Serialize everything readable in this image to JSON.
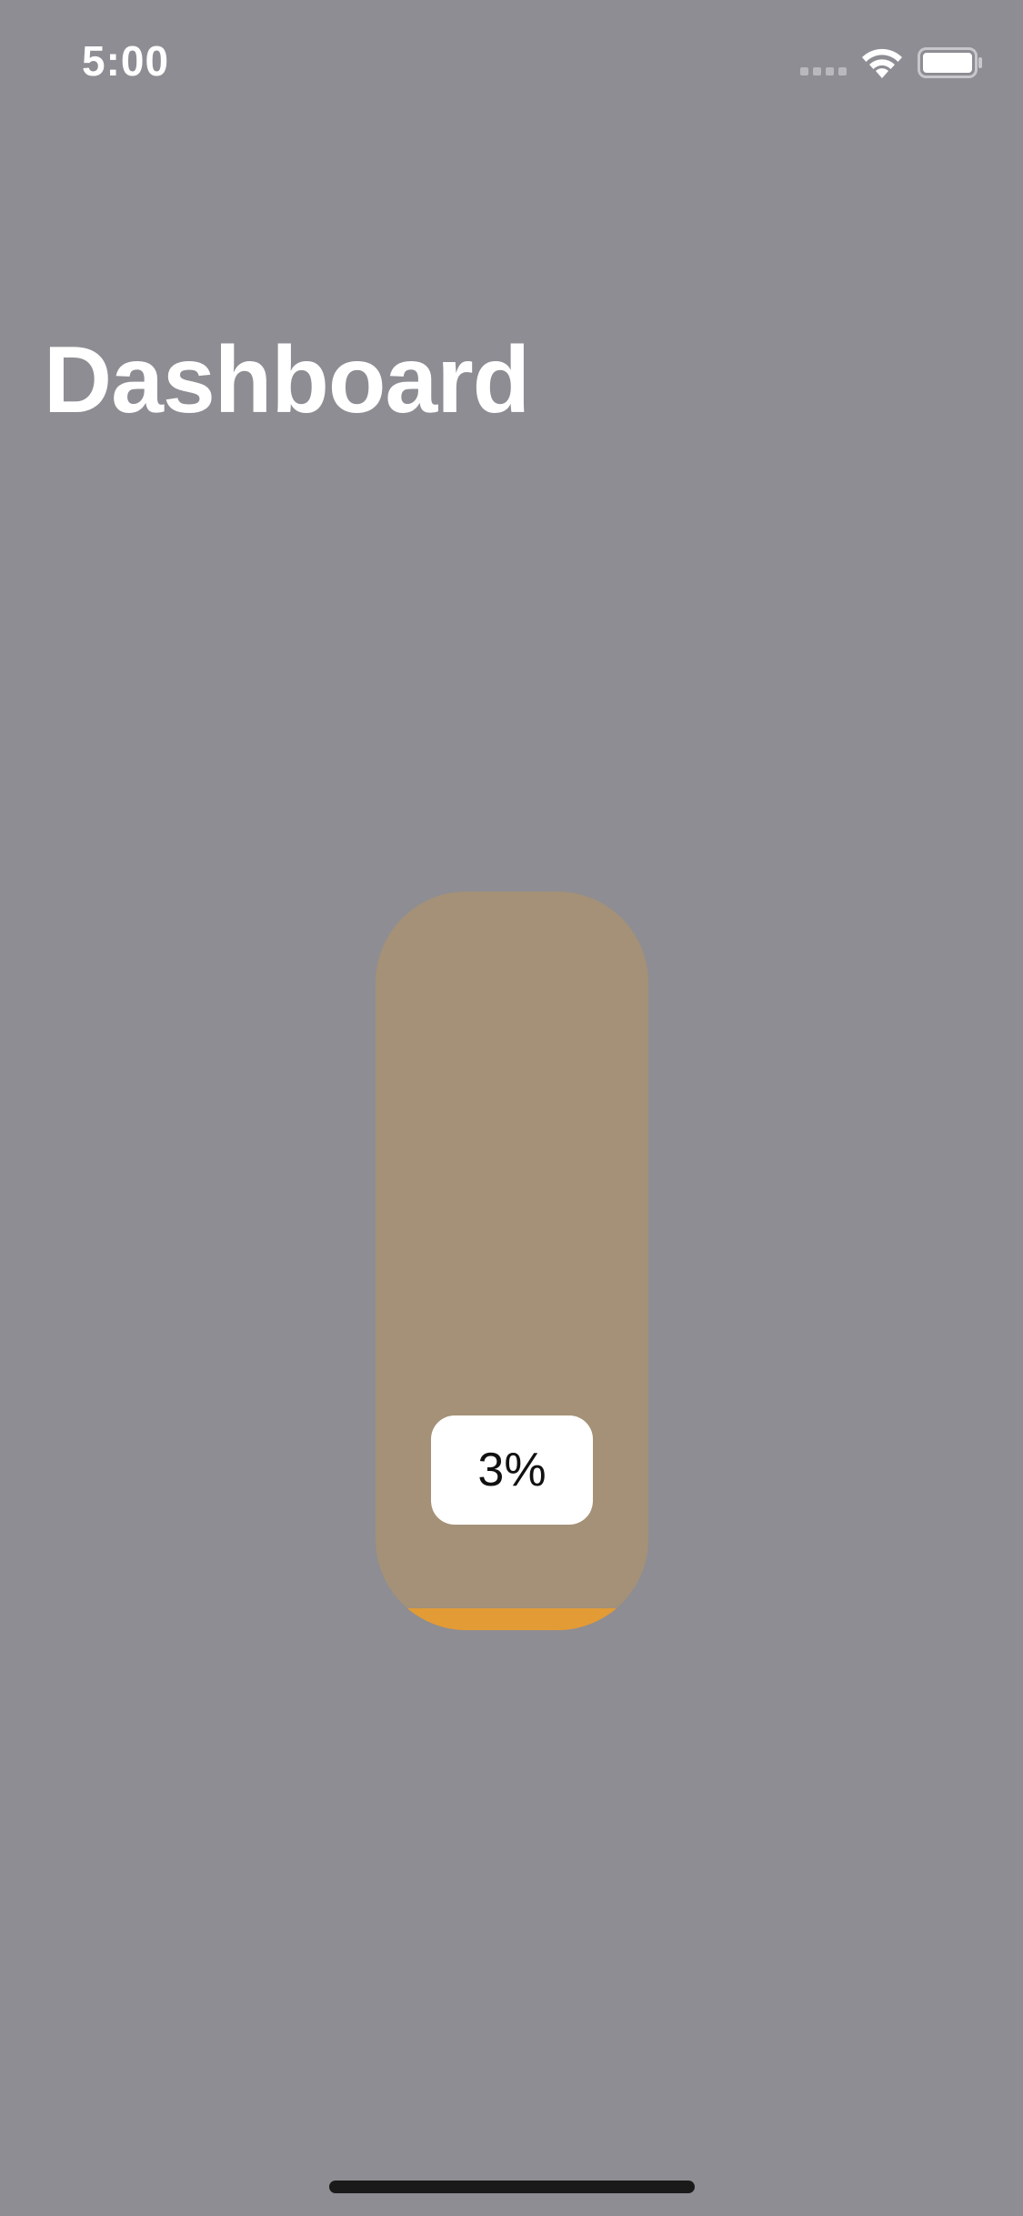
{
  "status_bar": {
    "time": "5:00",
    "icons": [
      "cellular-signal-icon",
      "wifi-icon",
      "battery-icon"
    ]
  },
  "page": {
    "title": "Dashboard"
  },
  "slider": {
    "value_label": "3%",
    "value_percent": 3,
    "track_color": "#a49177",
    "fill_color": "#e39b35"
  },
  "colors": {
    "background": "#8e8d93",
    "title": "#ffffff",
    "badge_background": "#ffffff"
  }
}
